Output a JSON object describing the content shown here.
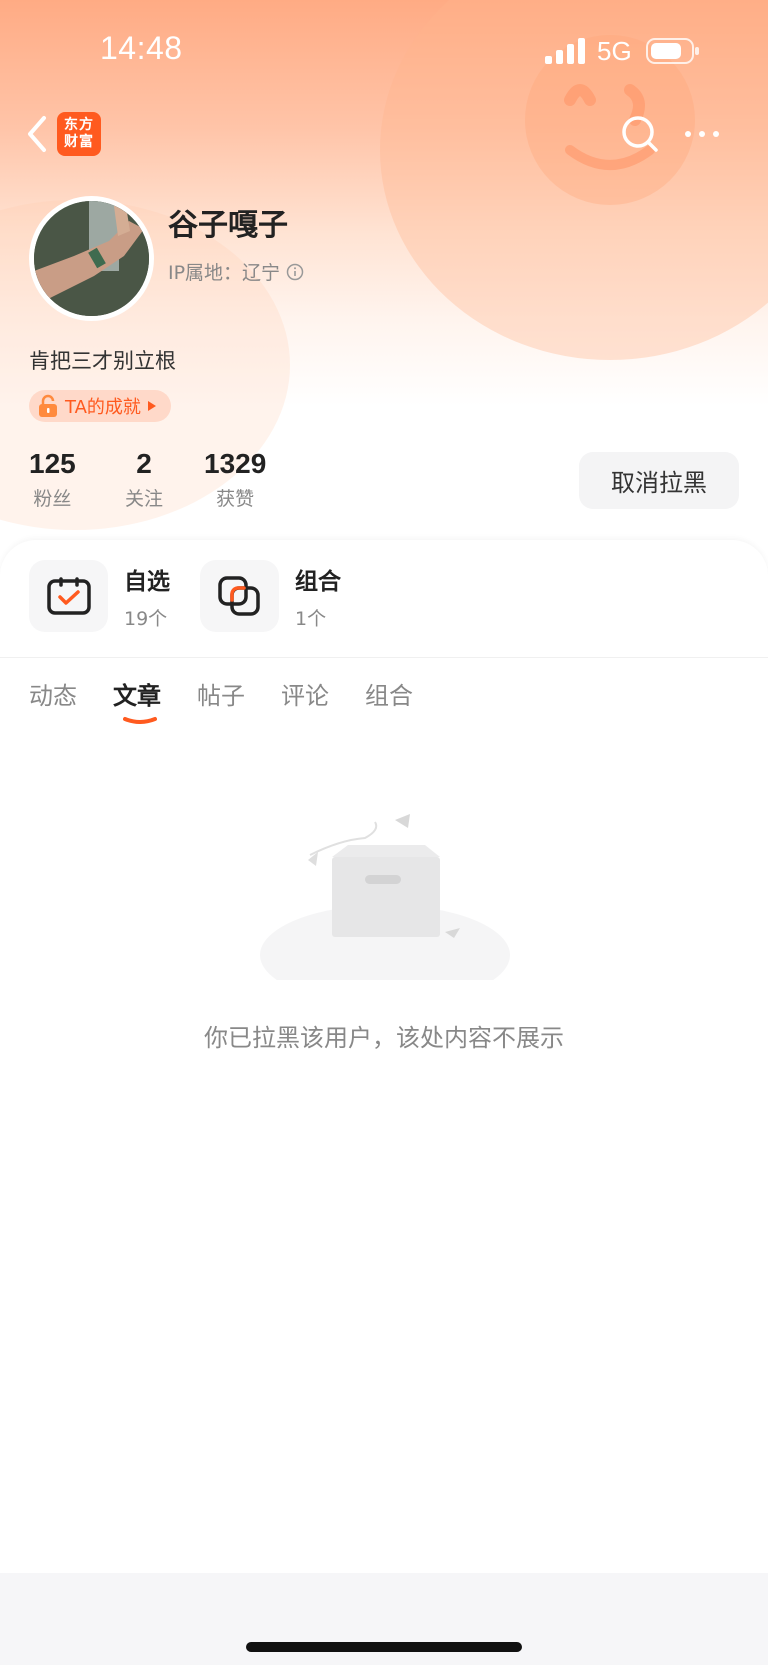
{
  "status_bar": {
    "time": "14:48",
    "network": "5G",
    "icons": [
      "signal-icon",
      "battery-icon"
    ]
  },
  "nav": {
    "logo_line1": "东方",
    "logo_line2": "财富",
    "icons": [
      "back-icon",
      "search-icon",
      "more-icon"
    ],
    "brand_color": "#ff5a1f"
  },
  "profile": {
    "username": "谷子嘎子",
    "ip_label": "IP属地：辽宁",
    "bio": "肯把三才别立根",
    "achievement_label": "TA的成就"
  },
  "stats": [
    {
      "value": "125",
      "label": "粉丝"
    },
    {
      "value": "2",
      "label": "关注"
    },
    {
      "value": "1329",
      "label": "获赞"
    }
  ],
  "unblock_button": "取消拉黑",
  "quick_items": [
    {
      "title": "自选",
      "count": "19个",
      "icon": "watchlist-check-icon"
    },
    {
      "title": "组合",
      "count": "1个",
      "icon": "portfolio-combo-icon"
    }
  ],
  "tabs": [
    {
      "label": "动态",
      "active": false
    },
    {
      "label": "文章",
      "active": true
    },
    {
      "label": "帖子",
      "active": false
    },
    {
      "label": "评论",
      "active": false
    },
    {
      "label": "组合",
      "active": false
    }
  ],
  "empty_state": {
    "message": "你已拉黑该用户，该处内容不展示",
    "icon": "empty-box-icon"
  },
  "colors": {
    "accent": "#ff5a1f",
    "header_gradient_top": "#ffab84",
    "text_primary": "#222222",
    "text_secondary": "#888888"
  }
}
